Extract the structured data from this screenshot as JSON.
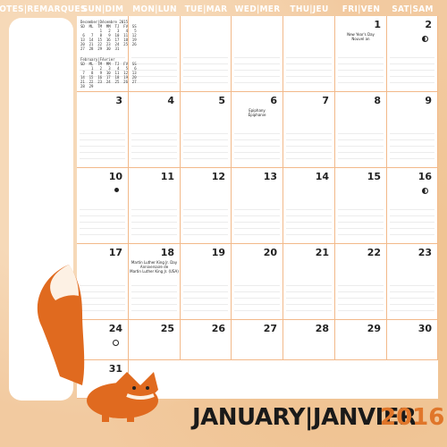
{
  "headers": [
    "NOTES|REMARQUES",
    "SUN|DIM",
    "MON|LUN",
    "TUE|MAR",
    "WED|MER",
    "THU|JEU",
    "FRI|VEN",
    "SAT|SAM"
  ],
  "mini_cal_dec": "December|Décembre 2015\nSD  ML  TM  MM  TJ  FV  SS\n         1   2   3   4   5\n 6   7   8   9  10  11  12\n13  14  15  16  17  18  19\n20  21  22  23  24  25  26\n27  28  29  30  31",
  "mini_cal_feb": "February|Février\nSD  ML  TM  MM  TJ  FV  SS\n     1   2   3   4   5   6\n 7   8   9  10  11  12  13\n14  15  16  17  18  19  20\n21  22  23  24  25  26  27\n28  29",
  "weeks": [
    [
      "",
      "",
      "",
      "",
      "",
      "1",
      "2"
    ],
    [
      "3",
      "4",
      "5",
      "6",
      "7",
      "8",
      "9"
    ],
    [
      "10",
      "11",
      "12",
      "13",
      "14",
      "15",
      "16"
    ],
    [
      "17",
      "18",
      "19",
      "20",
      "21",
      "22",
      "23"
    ],
    [
      "24",
      "25",
      "26",
      "27",
      "28",
      "29",
      "30"
    ],
    [
      "31",
      "",
      "",
      "",
      "",
      "",
      ""
    ]
  ],
  "events": {
    "new_year": "New Year's Day\nNouvel an",
    "epiphany": "Epiphany\nÉpiphanie",
    "mlk": "Martin Luther King Jr. Day\nAnniversaire de\nMartin Luther King Jr. (USA)"
  },
  "title": "JANUARY|JANVIER",
  "year": "2016"
}
